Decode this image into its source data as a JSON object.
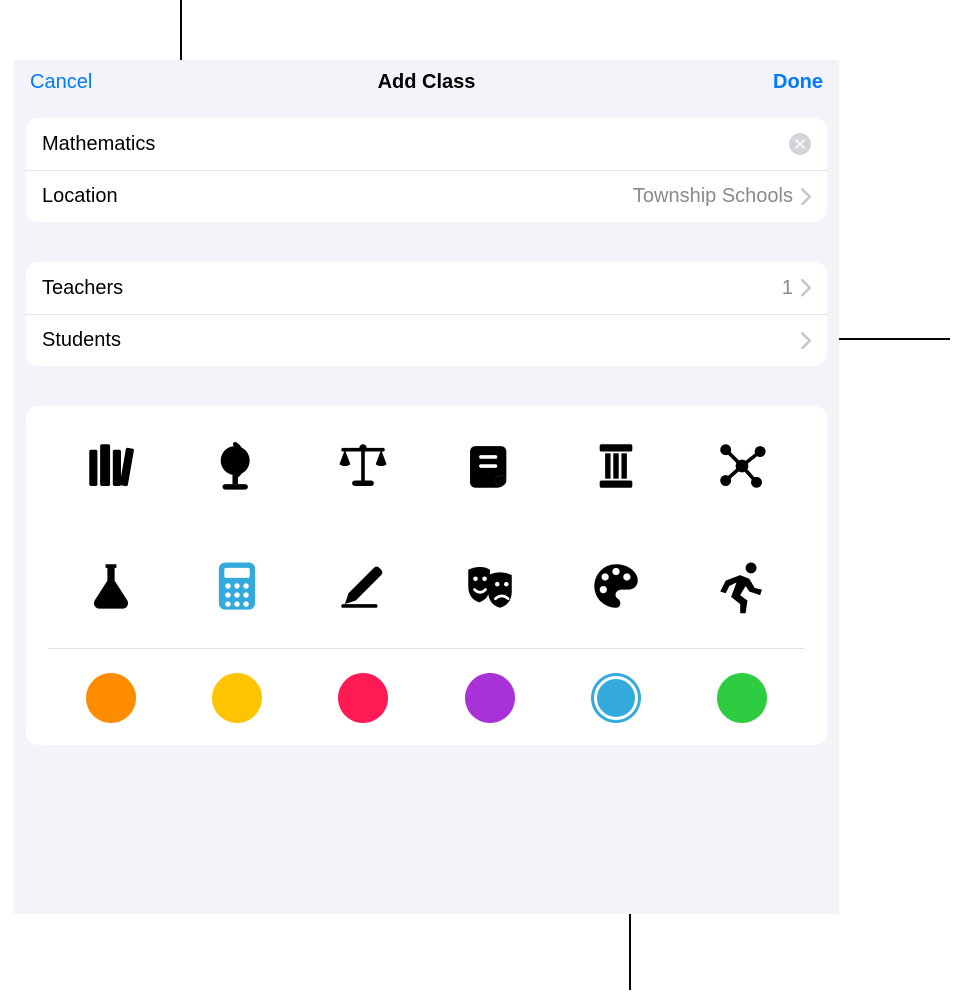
{
  "nav": {
    "cancel": "Cancel",
    "title": "Add Class",
    "done": "Done"
  },
  "class": {
    "name_value": "Mathematics",
    "location_label": "Location",
    "location_value": "Township Schools"
  },
  "people": {
    "teachers_label": "Teachers",
    "teachers_count": "1",
    "students_label": "Students",
    "students_count": ""
  },
  "icons": [
    {
      "name": "books-icon"
    },
    {
      "name": "globe-icon"
    },
    {
      "name": "scales-icon"
    },
    {
      "name": "scroll-icon"
    },
    {
      "name": "column-icon"
    },
    {
      "name": "molecule-icon"
    },
    {
      "name": "flask-icon"
    },
    {
      "name": "calculator-icon",
      "selected": true
    },
    {
      "name": "pencil-icon"
    },
    {
      "name": "theater-masks-icon"
    },
    {
      "name": "palette-icon"
    },
    {
      "name": "runner-icon"
    }
  ],
  "colors": [
    {
      "name": "orange",
      "hex": "#ff8c00"
    },
    {
      "name": "yellow",
      "hex": "#ffc400"
    },
    {
      "name": "pink",
      "hex": "#ff1a54"
    },
    {
      "name": "purple",
      "hex": "#a832d8"
    },
    {
      "name": "blue",
      "hex": "#34aadc",
      "selected": true
    },
    {
      "name": "green",
      "hex": "#2ecc40"
    }
  ]
}
